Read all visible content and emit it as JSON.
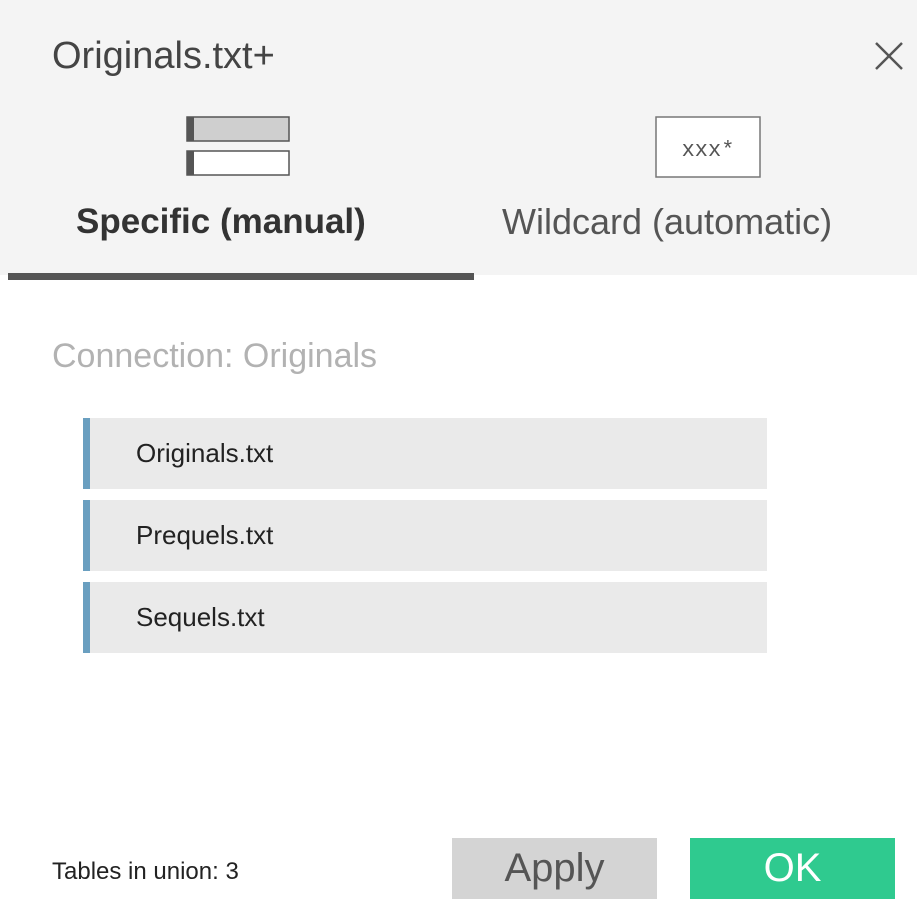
{
  "dialog": {
    "title": "Originals.txt+",
    "close_icon": "close-icon"
  },
  "tabs": [
    {
      "label": "Specific (manual)",
      "icon": "two-rows-icon",
      "active": true
    },
    {
      "label": "Wildcard (automatic)",
      "icon": "wildcard-icon",
      "icon_text": "xxx*",
      "active": false
    }
  ],
  "connection": {
    "label": "Connection: Originals"
  },
  "tables": [
    {
      "label": "Originals.txt"
    },
    {
      "label": "Prequels.txt"
    },
    {
      "label": "Sequels.txt"
    }
  ],
  "footer": {
    "union_count": "Tables in union: 3",
    "apply_label": "Apply",
    "ok_label": "OK"
  },
  "colors": {
    "header_bg": "#f4f4f4",
    "accent_bar": "#6a9fc0",
    "ok_button": "#2fca8f",
    "apply_button": "#d4d4d4",
    "active_tab_underline": "#555555"
  }
}
